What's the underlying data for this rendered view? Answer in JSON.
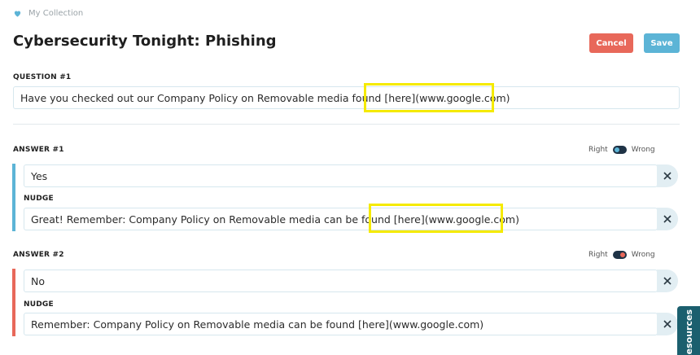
{
  "breadcrumb": {
    "label": "My Collection",
    "icon": "heart-icon"
  },
  "page": {
    "title": "Cybersecurity Tonight: Phishing"
  },
  "actions": {
    "cancel_label": "Cancel",
    "save_label": "Save"
  },
  "question": {
    "label": "QUESTION #1",
    "text": "Have you checked out our Company Policy on Removable media found [here](www.google.com)"
  },
  "answers": [
    {
      "label": "ANSWER #1",
      "text": "Yes",
      "nudge_label": "NUDGE",
      "nudge": "Great! Remember: Company Policy on Removable media can be found [here](www.google.com)",
      "toggle": {
        "right_label": "Right",
        "wrong_label": "Wrong",
        "state": "Right"
      }
    },
    {
      "label": "ANSWER #2",
      "text": "No",
      "nudge_label": "NUDGE",
      "nudge": "Remember: Company Policy on Removable media can be found [here](www.google.com)",
      "toggle": {
        "right_label": "Right",
        "wrong_label": "Wrong",
        "state": "Wrong"
      }
    }
  ],
  "side_tab": {
    "label": "Resources"
  },
  "colors": {
    "accent_blue": "#5cb4d6",
    "accent_red": "#e8685a",
    "highlight": "#f5ea00",
    "tab": "#1b5f6e"
  }
}
